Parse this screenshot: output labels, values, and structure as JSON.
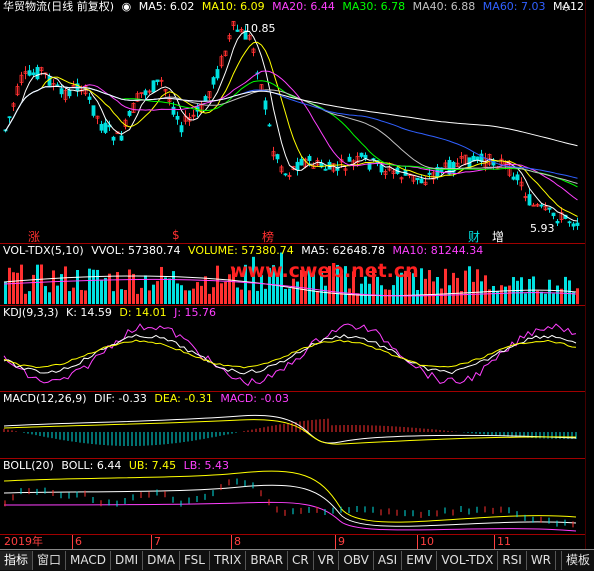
{
  "main": {
    "title": "华贸物流(日线 前复权)",
    "ma_items": [
      {
        "label": "MA5: 6.02",
        "color": "#ffffff"
      },
      {
        "label": "MA10: 6.09",
        "color": "#ffff00"
      },
      {
        "label": "MA20: 6.44",
        "color": "#ff40ff"
      },
      {
        "label": "MA30: 6.78",
        "color": "#00ff00"
      },
      {
        "label": "MA40: 6.88",
        "color": "#c0c0c0"
      },
      {
        "label": "MA60: 7.03",
        "color": "#3060ff"
      },
      {
        "label": "MA12",
        "color": "#ffffff"
      }
    ],
    "high_label": "10.85",
    "low_label": "5.93",
    "markers": [
      "涨",
      "$",
      "榜",
      "财",
      "增"
    ]
  },
  "volume": {
    "name": "VOL-TDX(5,10)",
    "vvol": "VVOL: 57380.74",
    "volume": "VOLUME: 57380.74",
    "ma5": "MA5: 62648.78",
    "ma10": "MA10: 81244.34",
    "watermark": "www.cweb.net.cn"
  },
  "kdj": {
    "name": "KDJ(9,3,3)",
    "k": "K: 14.59",
    "d": "D: 14.01",
    "j": "J: 15.76"
  },
  "macd": {
    "name": "MACD(12,26,9)",
    "dif": "DIF: -0.33",
    "dea": "DEA: -0.31",
    "macd": "MACD: -0.03"
  },
  "boll": {
    "name": "BOLL(20)",
    "boll": "BOLL: 6.44",
    "ub": "UB: 7.45",
    "lb": "LB: 5.43"
  },
  "axis": {
    "year": "2019年",
    "months": [
      "6",
      "7",
      "8",
      "9",
      "10",
      "11"
    ]
  },
  "tabs": [
    "指标",
    "窗口",
    "MACD",
    "DMI",
    "DMA",
    "FSL",
    "TRIX",
    "BRAR",
    "CR",
    "VR",
    "OBV",
    "ASI",
    "EMV",
    "VOL-TDX",
    "RSI",
    "WR"
  ],
  "tab_right": "模板",
  "colors": {
    "up": "#ff3030",
    "down": "#00e0e0",
    "border": "#a00000"
  }
}
